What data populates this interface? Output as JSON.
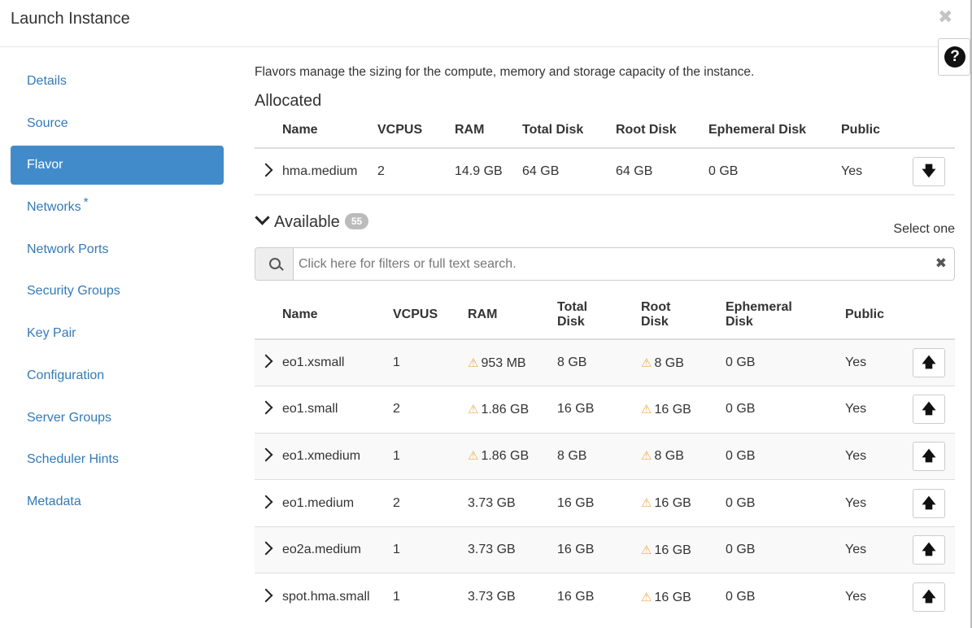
{
  "modal": {
    "title": "Launch Instance",
    "close_glyph": "✖",
    "help_glyph": "?"
  },
  "nav": {
    "items": [
      {
        "label": "Details",
        "active": false
      },
      {
        "label": "Source",
        "active": false
      },
      {
        "label": "Flavor",
        "active": true
      },
      {
        "label": "Networks",
        "active": false,
        "required_mark": "*"
      },
      {
        "label": "Network Ports",
        "active": false
      },
      {
        "label": "Security Groups",
        "active": false
      },
      {
        "label": "Key Pair",
        "active": false
      },
      {
        "label": "Configuration",
        "active": false
      },
      {
        "label": "Server Groups",
        "active": false
      },
      {
        "label": "Scheduler Hints",
        "active": false
      },
      {
        "label": "Metadata",
        "active": false
      }
    ]
  },
  "main": {
    "description": "Flavors manage the sizing for the compute, memory and storage capacity of the instance.",
    "allocated": {
      "title": "Allocated",
      "columns": [
        "Name",
        "VCPUS",
        "RAM",
        "Total Disk",
        "Root Disk",
        "Ephemeral Disk",
        "Public"
      ],
      "rows": [
        {
          "name": "hma.medium",
          "vcpus": "2",
          "ram": "14.9 GB",
          "total_disk": "64 GB",
          "root_disk": "64 GB",
          "ephemeral": "0 GB",
          "public": "Yes"
        }
      ],
      "action_icon": "arrow-down-icon",
      "action_glyph": "🡇"
    },
    "available": {
      "title": "Available",
      "count": "55",
      "select_hint": "Select one",
      "search_placeholder": "Click here for filters or full text search.",
      "clear_glyph": "✖",
      "columns": {
        "name": "Name",
        "vcpus": "VCPUS",
        "ram": "RAM",
        "total_disk_1": "Total",
        "total_disk_2": "Disk",
        "root_disk_1": "Root",
        "root_disk_2": "Disk",
        "ephemeral_1": "Ephemeral",
        "ephemeral_2": "Disk",
        "public": "Public"
      },
      "warn_glyph": "⚠",
      "warn_color": "#f0ad4e",
      "action_icon": "arrow-up-icon",
      "action_glyph": "🡅",
      "rows": [
        {
          "name": "eo1.xsmall",
          "vcpus": "1",
          "ram": "953 MB",
          "ram_warn": true,
          "total_disk": "8 GB",
          "root_disk": "8 GB",
          "root_warn": true,
          "ephemeral": "0 GB",
          "public": "Yes"
        },
        {
          "name": "eo1.small",
          "vcpus": "2",
          "ram": "1.86 GB",
          "ram_warn": true,
          "total_disk": "16 GB",
          "root_disk": "16 GB",
          "root_warn": true,
          "ephemeral": "0 GB",
          "public": "Yes"
        },
        {
          "name": "eo1.xmedium",
          "vcpus": "1",
          "ram": "1.86 GB",
          "ram_warn": true,
          "total_disk": "8 GB",
          "root_disk": "8 GB",
          "root_warn": true,
          "ephemeral": "0 GB",
          "public": "Yes"
        },
        {
          "name": "eo1.medium",
          "vcpus": "2",
          "ram": "3.73 GB",
          "ram_warn": false,
          "total_disk": "16 GB",
          "root_disk": "16 GB",
          "root_warn": true,
          "ephemeral": "0 GB",
          "public": "Yes"
        },
        {
          "name": "eo2a.medium",
          "vcpus": "1",
          "ram": "3.73 GB",
          "ram_warn": false,
          "total_disk": "16 GB",
          "root_disk": "16 GB",
          "root_warn": true,
          "ephemeral": "0 GB",
          "public": "Yes"
        },
        {
          "name": "spot.hma.small",
          "vcpus": "1",
          "ram": "3.73 GB",
          "ram_warn": false,
          "total_disk": "16 GB",
          "root_disk": "16 GB",
          "root_warn": true,
          "ephemeral": "0 GB",
          "public": "Yes"
        }
      ]
    }
  },
  "colors": {
    "accent": "#428bca",
    "link": "#337ab7",
    "warning": "#f0ad4e"
  }
}
